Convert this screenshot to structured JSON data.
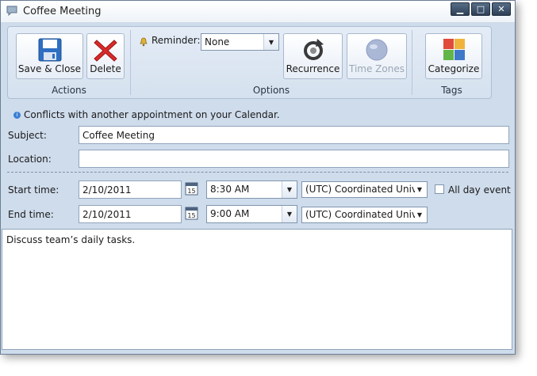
{
  "window": {
    "title": "Coffee Meeting",
    "minimize": "▁",
    "maximize": "□",
    "close": "✕"
  },
  "ribbon": {
    "actions": {
      "group_label": "Actions",
      "save_close": "Save & Close",
      "delete": "Delete"
    },
    "options": {
      "group_label": "Options",
      "reminder_label": "Reminder:",
      "reminder_value": "None",
      "recurrence": "Recurrence",
      "time_zones": "Time Zones"
    },
    "tags": {
      "group_label": "Tags",
      "categorize": "Categorize"
    }
  },
  "conflict_message": "Conflicts with another appointment on your Calendar.",
  "form": {
    "subject_label": "Subject:",
    "subject_value": "Coffee Meeting",
    "location_label": "Location:",
    "location_value": "",
    "start_label": "Start time:",
    "start_date": "2/10/2011",
    "start_time": "8:30 AM",
    "start_tz": "(UTC) Coordinated Univ",
    "end_label": "End time:",
    "end_date": "2/10/2011",
    "end_time": "9:00 AM",
    "end_tz": "(UTC) Coordinated Univ",
    "calendar_icon_day": "15",
    "all_day_label": "All day event",
    "all_day_checked": false
  },
  "notes": "Discuss team’s daily tasks."
}
